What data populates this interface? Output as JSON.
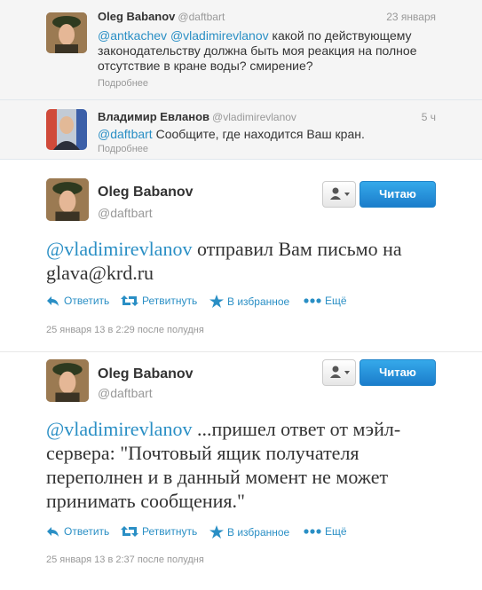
{
  "context_tweets": [
    {
      "name": "Oleg Babanov",
      "handle": "@daftbart",
      "time": "23 января",
      "mention1": "@antkachev",
      "mention2": "@vladimirevlanov",
      "text_line1": "какой по действующему",
      "text_line2": "законодательству должна быть моя реакция на полное",
      "text_line3": "отсутствие в кране воды? смирение?",
      "more_label": "Подробнее"
    },
    {
      "name": "Владимир Евланов",
      "handle": "@vladimirevlanov",
      "time": "5 ч",
      "mention": "@daftbart",
      "text": "Сообщите, где находится Ваш кран.",
      "more_label": "Подробнее"
    }
  ],
  "tweets": [
    {
      "name": "Oleg Babanov",
      "handle": "@daftbart",
      "follow_label": "Читаю",
      "mention": "@vladimirevlanov",
      "text": "отправил Вам письмо на glava@krd.ru",
      "actions": {
        "reply": "Ответить",
        "retweet": "Ретвитнуть",
        "favorite": "В избранное",
        "more": "Ещё"
      },
      "date": "25 января 13 в 2:29 после полудня"
    },
    {
      "name": "Oleg Babanov",
      "handle": "@daftbart",
      "follow_label": "Читаю",
      "mention": "@vladimirevlanov",
      "text": "...пришел ответ от мэйл-сервера: \"Почтовый ящик получателя переполнен и в данный момент не может принимать сообщения.\"",
      "actions": {
        "reply": "Ответить",
        "retweet": "Ретвитнуть",
        "favorite": "В избранное",
        "more": "Ещё"
      },
      "date": "25 января 13 в 2:37 после полудня"
    }
  ],
  "icons": {
    "reply": "reply-arrow-icon",
    "retweet": "retweet-icon",
    "favorite": "star-icon",
    "more": "dots-icon",
    "user": "person-icon"
  },
  "colors": {
    "link": "#2a8fc5",
    "follow_button": "#2b8fd6",
    "muted": "#999999"
  }
}
